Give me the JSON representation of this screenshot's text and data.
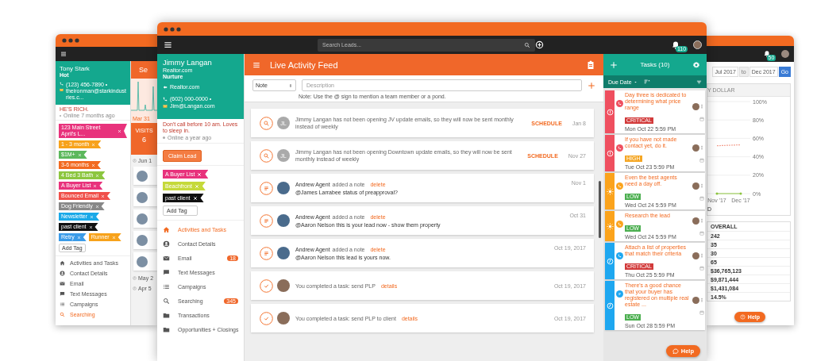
{
  "lead_window": {
    "name": "Tony Stark",
    "stage": "Hot",
    "phone": "(123) 456-7890 •",
    "email": "theironman@starkindustries.c...",
    "note": "HE'S RICH.",
    "online": "Online 7 months ago",
    "tags": [
      {
        "label": "123 Main Street April's L...",
        "color": "#e8327c"
      },
      {
        "label": "1 - 3 month",
        "color": "#f7a21b"
      },
      {
        "label": "$1M+",
        "color": "#5cb85c"
      },
      {
        "label": "3-6 months",
        "color": "#f26a21"
      },
      {
        "label": "4 Bed 3 Bath",
        "color": "#8cc63f"
      },
      {
        "label": "A Buyer List",
        "color": "#e8327c"
      },
      {
        "label": "Bounced Email",
        "color": "#f0504a"
      },
      {
        "label": "Dog Friendly",
        "color": "#888888"
      },
      {
        "label": "Newsletter",
        "color": "#1aa9e8"
      },
      {
        "label": "past client",
        "color": "#111111"
      },
      {
        "label": "Retry",
        "color": "#3b9be8"
      },
      {
        "label": "Runner",
        "color": "#f7a21b"
      }
    ],
    "add_tag": "Add Tag",
    "nav": [
      {
        "kind": "home",
        "label": "Activities and Tasks",
        "selected": false
      },
      {
        "kind": "person",
        "label": "Contact Details",
        "selected": false
      },
      {
        "kind": "mail",
        "label": "Email",
        "selected": false
      },
      {
        "kind": "chat",
        "label": "Text Messages",
        "selected": false
      },
      {
        "kind": "list",
        "label": "Campaigns",
        "selected": false
      },
      {
        "kind": "search",
        "label": "Searching",
        "selected": true
      }
    ],
    "content": {
      "title": "Se",
      "chart_label": "Mar 31",
      "stat_label": "VISITS",
      "stat_value": "6",
      "dates": [
        "Jun 1",
        "May 2",
        "Apr 5"
      ]
    }
  },
  "report_window": {
    "notification_count": "50",
    "date_from": "Jul 2017",
    "range_separator": "to",
    "date_to": "Dec 2017",
    "go_button": "Go",
    "card_title": "Y DOLLAR",
    "chart_data": {
      "type": "line",
      "grid": true,
      "x": [
        "Nov '17",
        "Dec '17"
      ],
      "ylim": [
        0,
        100
      ],
      "yticks": [
        {
          "value": 0,
          "label": "0%"
        },
        {
          "value": 20,
          "label": "20%"
        },
        {
          "value": 40,
          "label": "40%"
        },
        {
          "value": 60,
          "label": "60%"
        },
        {
          "value": 80,
          "label": "80%"
        },
        {
          "value": 100,
          "label": "100%"
        }
      ],
      "series": [
        {
          "color": "#f4a08f",
          "line_style": "dashed",
          "values": [
            52,
            53
          ]
        },
        {
          "color": "#8dc63f",
          "values": [
            0,
            0
          ]
        }
      ]
    },
    "legend": "D",
    "table": {
      "column": "OVERALL",
      "rows": [
        "242",
        "35",
        "30",
        "65",
        "$36,765,123",
        "$9,871,444",
        "$1,431,084",
        "14.5%"
      ]
    },
    "help": "Help"
  },
  "main_window": {
    "toolbar": {
      "search_placeholder": "Search Leads...",
      "notification_count": "110"
    },
    "lead": {
      "name": "Jimmy Langan",
      "source": "Realtor.com",
      "stage": "Nurture",
      "referrer": "Realtor.com",
      "phone": "(602) 000-0000 •",
      "email": "Jim@Langan.com",
      "note": "Don't call before 10 am. Loves to sleep in.",
      "online": "Online a year ago"
    },
    "claim_button": "Claim Lead",
    "tags": [
      {
        "label": "A Buyer List",
        "color": "#e8327c"
      },
      {
        "label": "Beachfront",
        "color": "#c5d93a"
      },
      {
        "label": "past client",
        "color": "#111111"
      }
    ],
    "add_tag": "Add Tag",
    "nav": [
      {
        "kind": "home",
        "label": "Activities and Tasks",
        "selected": true
      },
      {
        "kind": "person",
        "label": "Contact Details",
        "selected": false
      },
      {
        "kind": "mail",
        "label": "Email",
        "badge": "18",
        "selected": false
      },
      {
        "kind": "chat",
        "label": "Text Messages",
        "selected": false
      },
      {
        "kind": "list",
        "label": "Campaigns",
        "selected": false
      },
      {
        "kind": "search",
        "label": "Searching",
        "badge": "345",
        "selected": false
      },
      {
        "kind": "folder",
        "label": "Transactions",
        "selected": false
      },
      {
        "kind": "folder",
        "label": "Opportunities + Closings",
        "selected": false
      }
    ],
    "feed": {
      "title": "Live Activity Feed",
      "note_type": "Note",
      "placeholder": "Description",
      "hint": "Note: Use the @ sign to mention a team member or a pond.",
      "items": [
        {
          "kind": "schedule",
          "avatar": "JL",
          "text": "Jimmy Langan has not been opening JV update emails, so they will now be sent monthly instead of weekly",
          "action": "SCHEDULE",
          "date": "Jan 8"
        },
        {
          "kind": "schedule",
          "avatar": "JL",
          "text": "Jimmy Langan has not been opening Downtown update emails, so they will now be sent monthly instead of weekly",
          "action": "SCHEDULE",
          "date": "Nov 27"
        },
        {
          "kind": "note",
          "author": "Andrew Agent",
          "text": "added a note",
          "action": "delete",
          "body": "@James Larrabee status of preapproval?",
          "date": "Nov 1"
        },
        {
          "kind": "note",
          "author": "Andrew Agent",
          "text": "added a note",
          "action": "delete",
          "body": "@Aaron Nelson this is your lead now - show them property",
          "date": "Oct 31"
        },
        {
          "kind": "note",
          "author": "Andrew Agent",
          "text": "added a note",
          "action": "delete",
          "body": "@Aaron Nelson this lead is yours now.",
          "date": "Oct 19, 2017"
        },
        {
          "kind": "task",
          "text": "You completed a task: send PLP",
          "action": "details",
          "date": "Oct 19, 2017"
        },
        {
          "kind": "task",
          "text": "You completed a task: send PLP to client",
          "action": "details",
          "date": "Oct 19, 2017"
        }
      ]
    },
    "tasks": {
      "title": "Tasks (10)",
      "sort": "Due Date",
      "items": [
        {
          "kind": "call",
          "overdue": true,
          "due_today": false,
          "color": "#ef4f5f",
          "title": "Day three is dedicated to determining what price range",
          "priority": {
            "label": "CRITICAL",
            "color": "#d23a3a"
          },
          "due": "Mon Oct 22 5:59 PM"
        },
        {
          "kind": "call",
          "overdue": true,
          "due_today": false,
          "color": "#ef4f5f",
          "title": "If you have not made contact yet, do it.",
          "priority": {
            "label": "HIGH",
            "color": "#f5a623"
          },
          "due": "Tue Oct 23 5:59 PM"
        },
        {
          "kind": "call",
          "overdue": false,
          "due_today": true,
          "color": "#fba31c",
          "title": "Even the best agents need a day off.",
          "priority": {
            "label": "LOW",
            "color": "#4caf50"
          },
          "due": "Wed Oct 24 5:59 PM"
        },
        {
          "kind": "call",
          "overdue": false,
          "due_today": true,
          "color": "#fba31c",
          "title": "Research the lead",
          "priority": {
            "label": "LOW",
            "color": "#4caf50"
          },
          "due": "Wed Oct 24 5:59 PM"
        },
        {
          "kind": "call",
          "overdue": false,
          "due_today": false,
          "color": "#1ea7f0",
          "title": "Attach a list of properties that match their criteria",
          "priority": {
            "label": "CRITICAL",
            "color": "#d23a3a"
          },
          "due": "Thu Oct 25 5:59 PM"
        },
        {
          "kind": "note",
          "overdue": false,
          "due_today": false,
          "color": "#1ea7f0",
          "title": "There's a good chance that your buyer has registered on multiple real estate ...",
          "priority": {
            "label": "LOW",
            "color": "#4caf50"
          },
          "due": "Sun Oct 28 5:59 PM"
        }
      ]
    },
    "help": "Help"
  }
}
